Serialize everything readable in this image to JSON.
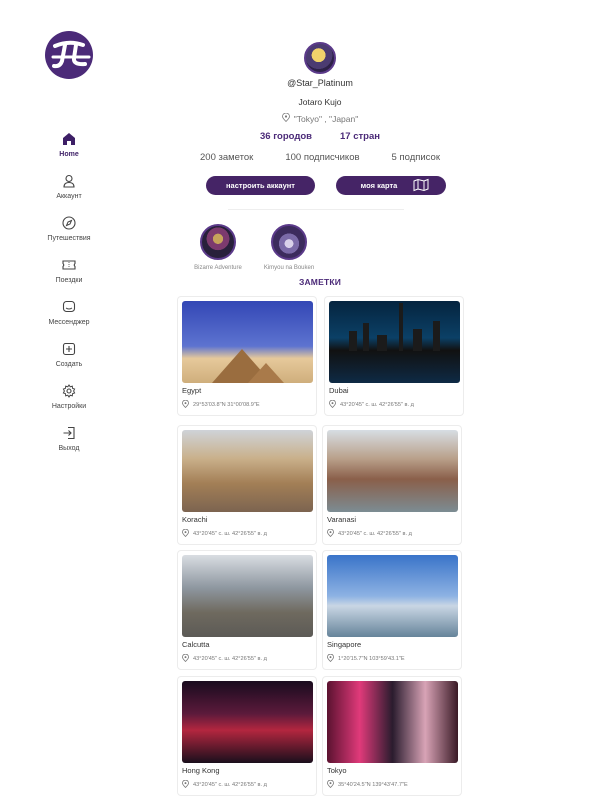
{
  "nav": {
    "items": [
      {
        "label": "Home",
        "icon": "home-icon",
        "active": true
      },
      {
        "label": "Аккаунт",
        "icon": "user-icon"
      },
      {
        "label": "Путешествия",
        "icon": "compass-icon"
      },
      {
        "label": "Поездки",
        "icon": "ticket-icon"
      },
      {
        "label": "Мессенджер",
        "icon": "chat-icon"
      },
      {
        "label": "Создать",
        "icon": "plus-square-icon"
      },
      {
        "label": "Настройки",
        "icon": "gear-icon"
      },
      {
        "label": "Выход",
        "icon": "logout-icon"
      }
    ]
  },
  "profile": {
    "username": "@Star_Platinum",
    "full_name": "Jotaro Kujo",
    "location": "\"Tokyo\" , \"Japan\"",
    "cities": "36 городов",
    "countries": "17 стран",
    "notes": "200 заметок",
    "followers": "100 подписчиков",
    "following": "5 подписок"
  },
  "buttons": {
    "settings": "настроить аккаунт",
    "map": "моя карта"
  },
  "highlights": [
    {
      "label": "Bizarre Adventure"
    },
    {
      "label": "Kimyou na Bouken"
    }
  ],
  "section_title": "ЗАМЕТКИ",
  "cards": [
    {
      "city": "Egypt",
      "coords": "29°53'03.8\"N 31°00'08.9\"E"
    },
    {
      "city": "Dubai",
      "coords": "43°20'45\" с. ш. 42°26'55\" в. д"
    },
    {
      "city": "Korachi",
      "coords": "43°20'45\" с. ш. 42°26'55\" в. д"
    },
    {
      "city": "Varanasi",
      "coords": "43°20'45\" с. ш. 42°26'55\" в. д"
    },
    {
      "city": "Calcutta",
      "coords": "43°20'45\" с. ш. 42°26'55\" в. д"
    },
    {
      "city": "Singapore",
      "coords": "1°20'15.7\"N 103°59'43.1\"E"
    },
    {
      "city": "Hong Kong",
      "coords": "43°20'45\" с. ш. 42°26'55\" в. д"
    },
    {
      "city": "Tokyo",
      "coords": "35°40'24.5\"N 139°43'47.7\"E"
    }
  ],
  "colors": {
    "primary": "#452466",
    "accent_text": "#4b2a78"
  }
}
